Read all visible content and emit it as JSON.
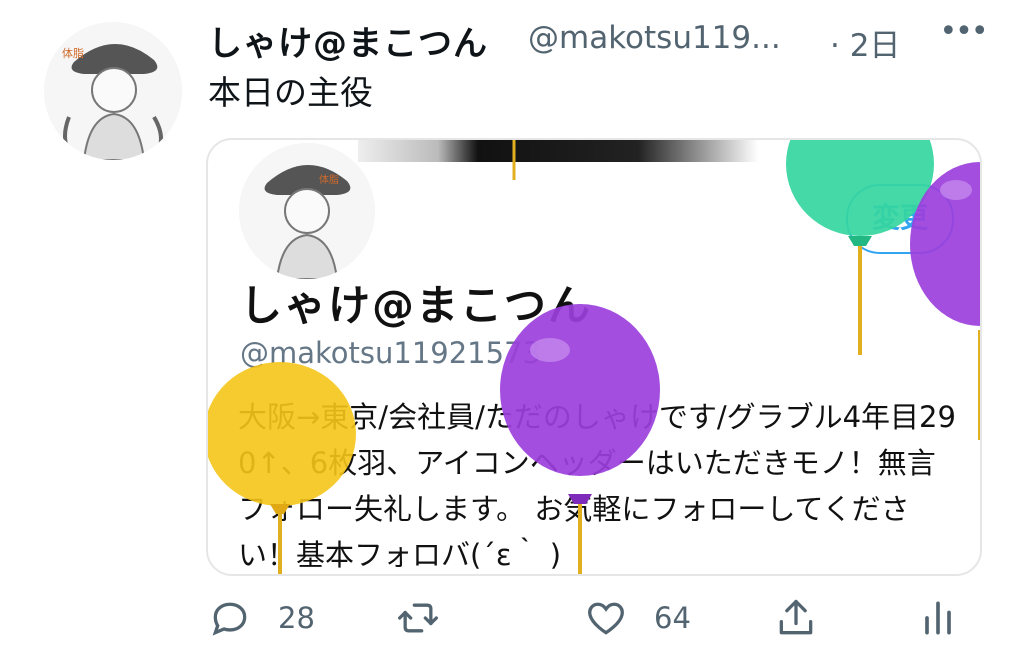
{
  "tweet": {
    "display_name": "しゃけ@まこつん",
    "handle": "@makotsu119...",
    "time": "· 2日",
    "more_icon": "more-icon",
    "text": "本日の主役"
  },
  "card": {
    "edit_label": "変更",
    "name": "しゃけ@まこつん",
    "handle": "@makotsu11921573",
    "bio": "大阪→東京/会社員/ただのしゃけです/グラブル4年目290↑、6枚羽、アイコンヘッダーはいただきモノ！無言フォロー失礼します。 お気軽にフォローしてください！基本フォロバ(´ε｀ )",
    "balloon_colors": [
      "#f5c518",
      "#9b3fdc",
      "#35d6a0",
      "#9b3fdc"
    ]
  },
  "actions": {
    "reply_count": "28",
    "like_count": "64",
    "reply_icon": "reply-icon",
    "retweet_icon": "retweet-icon",
    "like_icon": "like-icon",
    "share_icon": "share-icon",
    "analytics_icon": "analytics-icon"
  }
}
